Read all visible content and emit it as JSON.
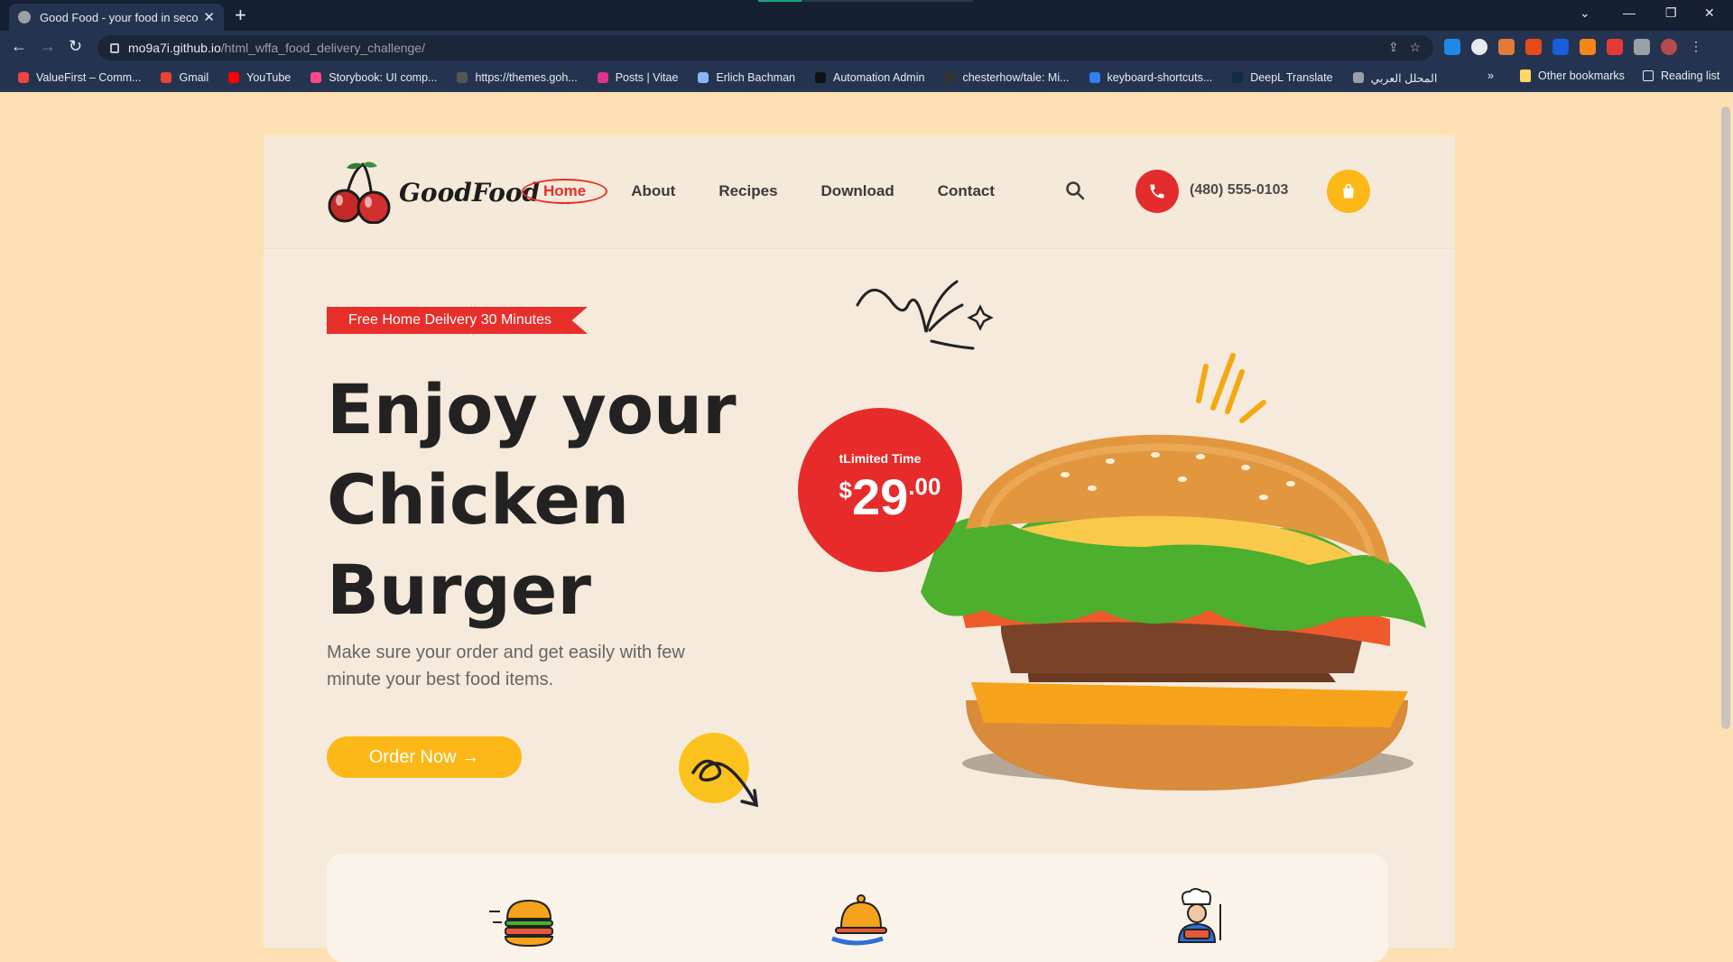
{
  "browser": {
    "tab_title": "Good Food - your food in seconds",
    "url_host": "mo9a7i.github.io",
    "url_path": "/html_wffa_food_delivery_challenge/",
    "bookmarks": [
      {
        "label": "ValueFirst – Comm...",
        "color": "#e44"
      },
      {
        "label": "Gmail",
        "color": "#ea4335"
      },
      {
        "label": "YouTube",
        "color": "#ff0000"
      },
      {
        "label": "Storybook: UI comp...",
        "color": "#ff4785"
      },
      {
        "label": "https://themes.goh...",
        "color": "#555"
      },
      {
        "label": "Posts | Vitae",
        "color": "#e0338c"
      },
      {
        "label": "Erlich Bachman",
        "color": "#8ab4f8"
      },
      {
        "label": "Automation Admin",
        "color": "#111"
      },
      {
        "label": "chesterhow/tale: Mi...",
        "color": "#333"
      },
      {
        "label": "keyboard-shortcuts...",
        "color": "#2f80ed"
      },
      {
        "label": "DeepL Translate",
        "color": "#0f2b46"
      },
      {
        "label": "المحلل العربي",
        "color": "#9aa0a6"
      }
    ],
    "more_bookmarks": "»",
    "other_bookmarks": "Other bookmarks",
    "reading_list": "Reading list"
  },
  "site": {
    "brand": "GoodFood",
    "nav": [
      "Home",
      "About",
      "Recipes",
      "Download",
      "Contact"
    ],
    "phone": "(480) 555-0103",
    "badge": "Free Home Deilvery 30 Minutes",
    "hero_title": "Enjoy your Chicken Burger",
    "hero_subtitle": "Make sure your order and get easily with few minute your best food items.",
    "cta": "Order Now →",
    "promo_label": "tLimited Time",
    "price_currency": "$",
    "price_int": "29",
    "price_dec": ".00",
    "colors": {
      "red": "#e72e2a",
      "yellow": "#fbb817",
      "bg": "#fde1b5",
      "card": "#f5eadb"
    }
  }
}
